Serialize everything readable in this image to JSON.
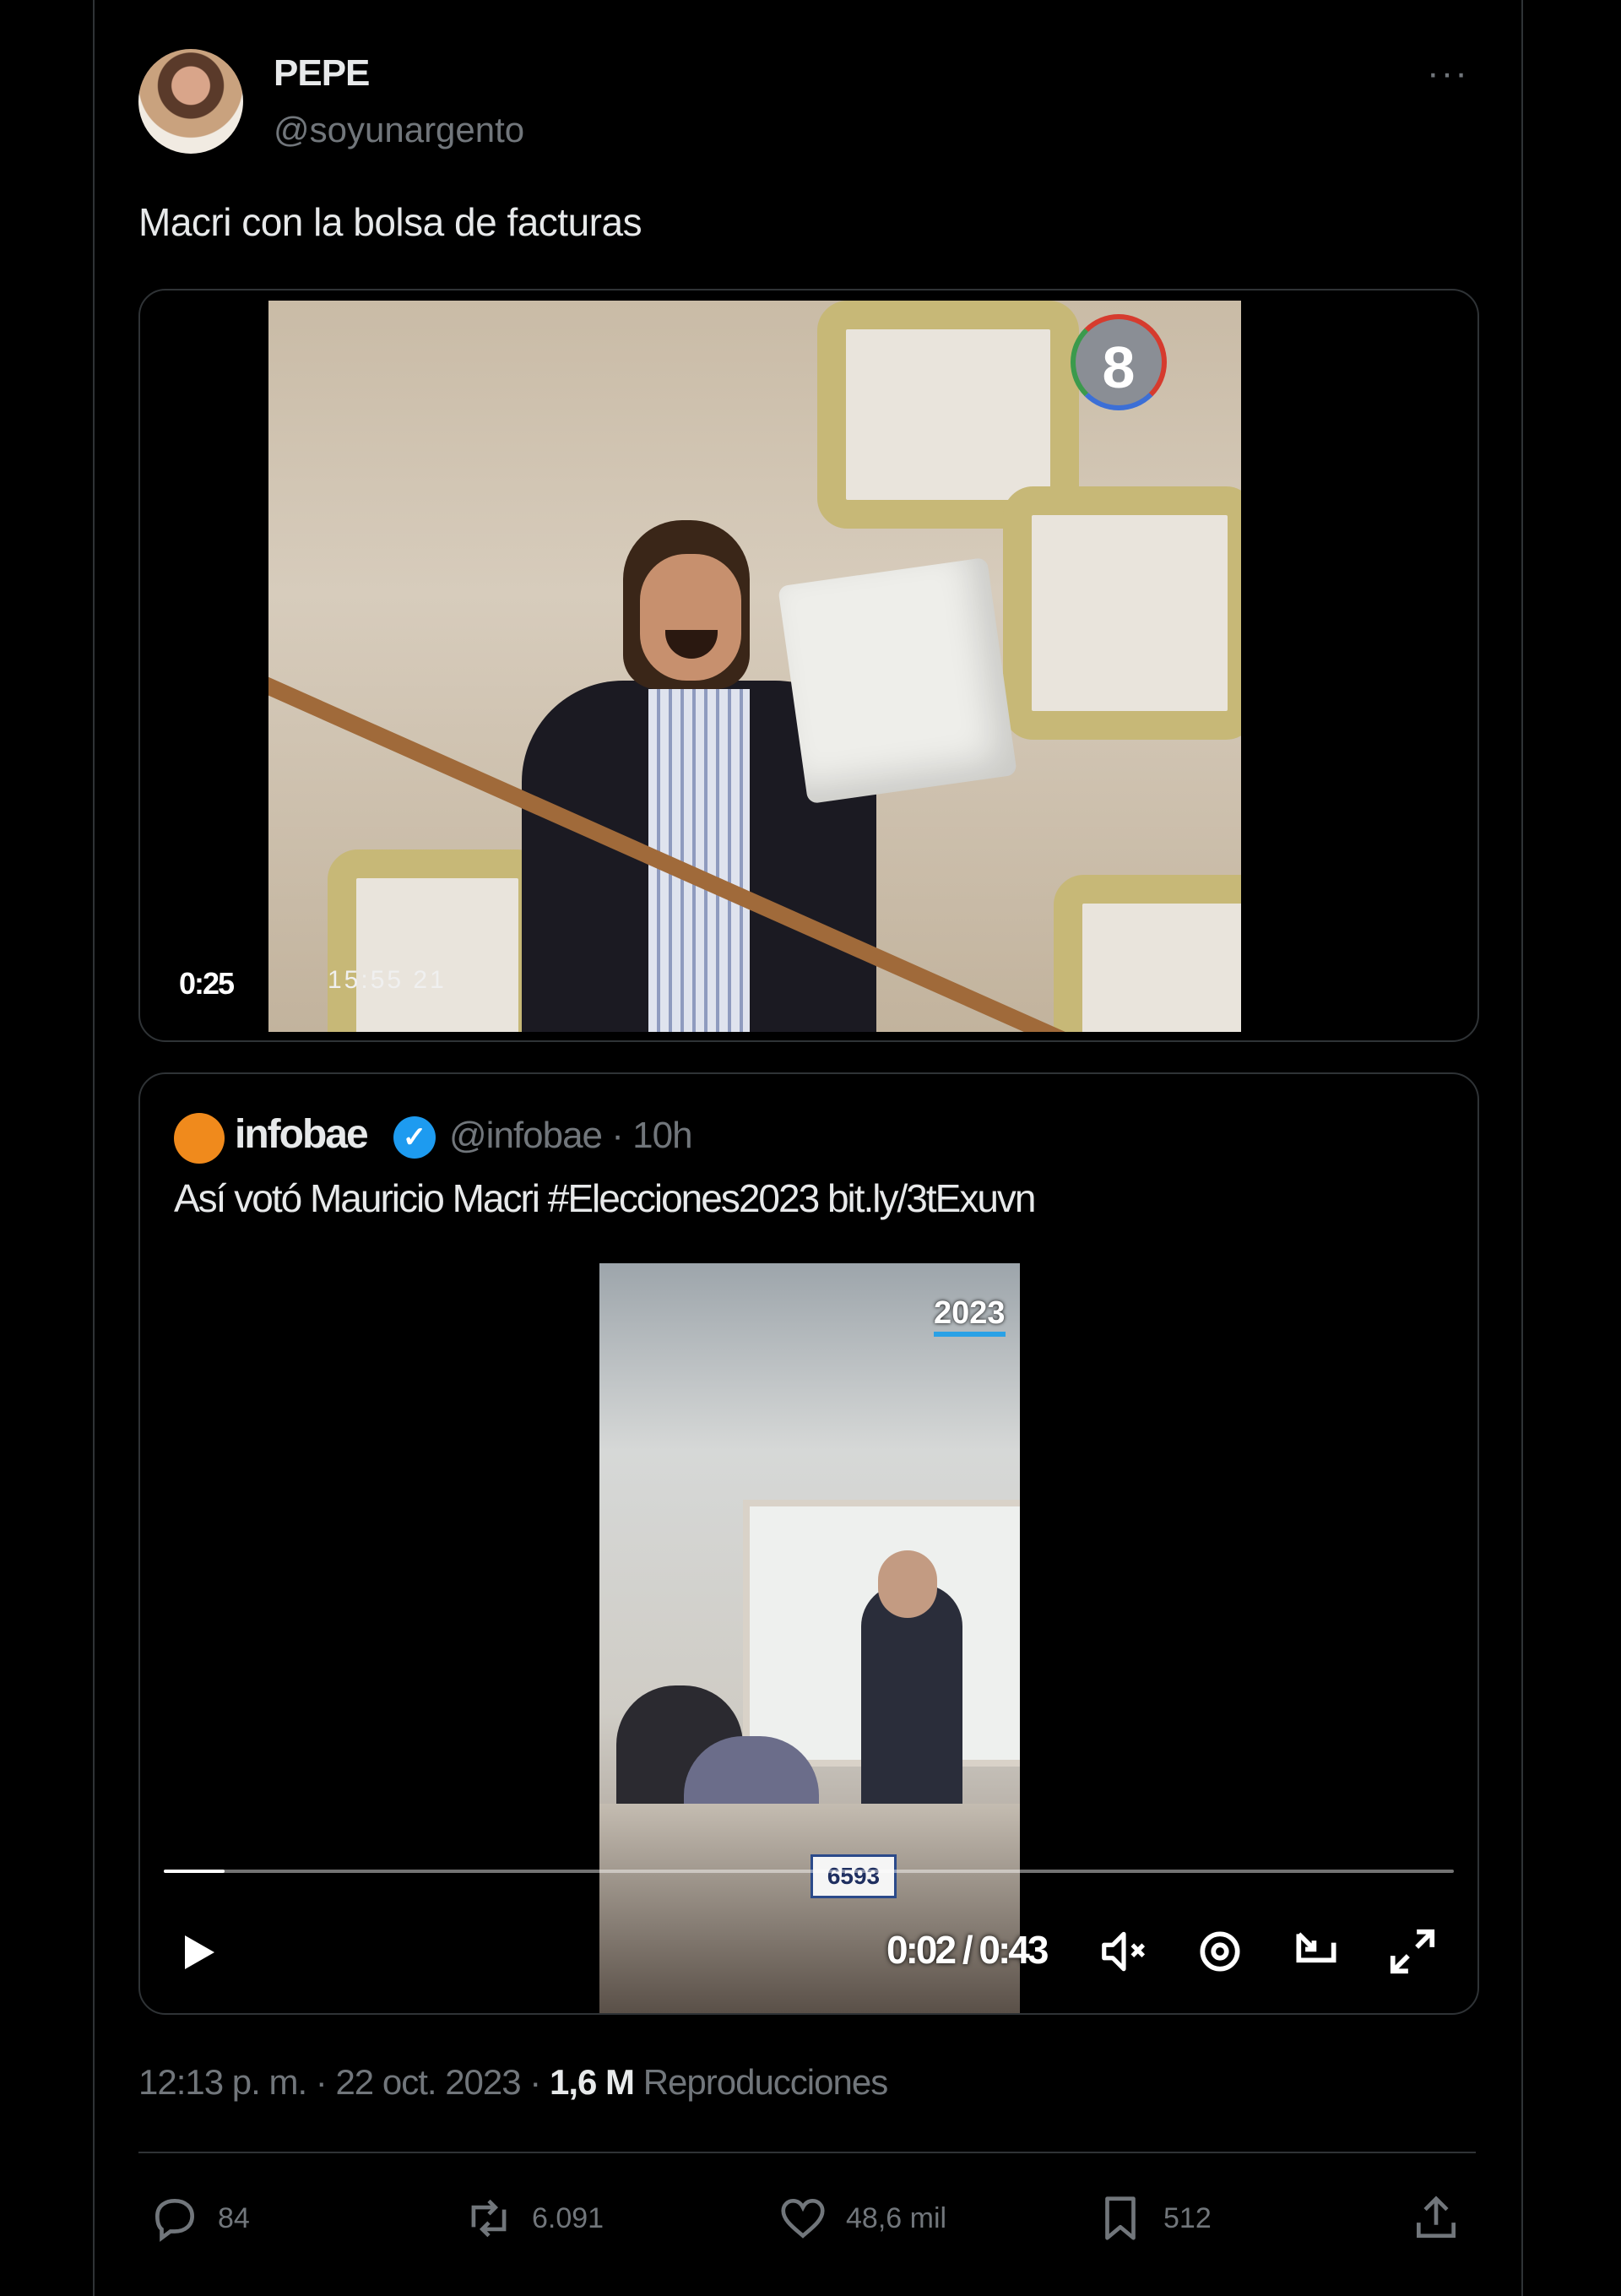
{
  "tweet": {
    "author_name": "PEPE",
    "author_handle": "@soyunargento",
    "more_icon": "···",
    "text": "Macri con la bolsa de facturas",
    "media": {
      "duration": "0:25",
      "channel_logo": "8",
      "osd_timestamp": "15:55  21"
    },
    "timestamp": "12:13 p. m. · 22 oct. 2023 ·",
    "views_count": "1,6 M",
    "views_label": "Reproducciones"
  },
  "quoted": {
    "author_name": "infobae",
    "author_handle": "@infobae · 10h",
    "text": "Así votó Mauricio Macri #Elecciones2023 bit.ly/3tExuvn",
    "video": {
      "overlay_tag": "2023",
      "table_sign": "6593",
      "current_time": "0:02 / 0:43",
      "progress": 0.047
    }
  },
  "actions": {
    "replies": "84",
    "retweets": "6.091",
    "likes": "48,6 mil",
    "bookmarks": "512"
  },
  "colors": {
    "background": "#000000",
    "text_primary": "#e7e9ea",
    "text_secondary": "#71767b",
    "border": "#2f3336",
    "verified": "#1d9bf0",
    "infobae_orange": "#f08a1c"
  },
  "icons": [
    "ellipsis-icon",
    "verified-badge-icon",
    "play-icon",
    "mute-icon",
    "settings-icon",
    "pip-icon",
    "fullscreen-icon",
    "reply-icon",
    "retweet-icon",
    "like-icon",
    "bookmark-icon",
    "share-icon"
  ]
}
